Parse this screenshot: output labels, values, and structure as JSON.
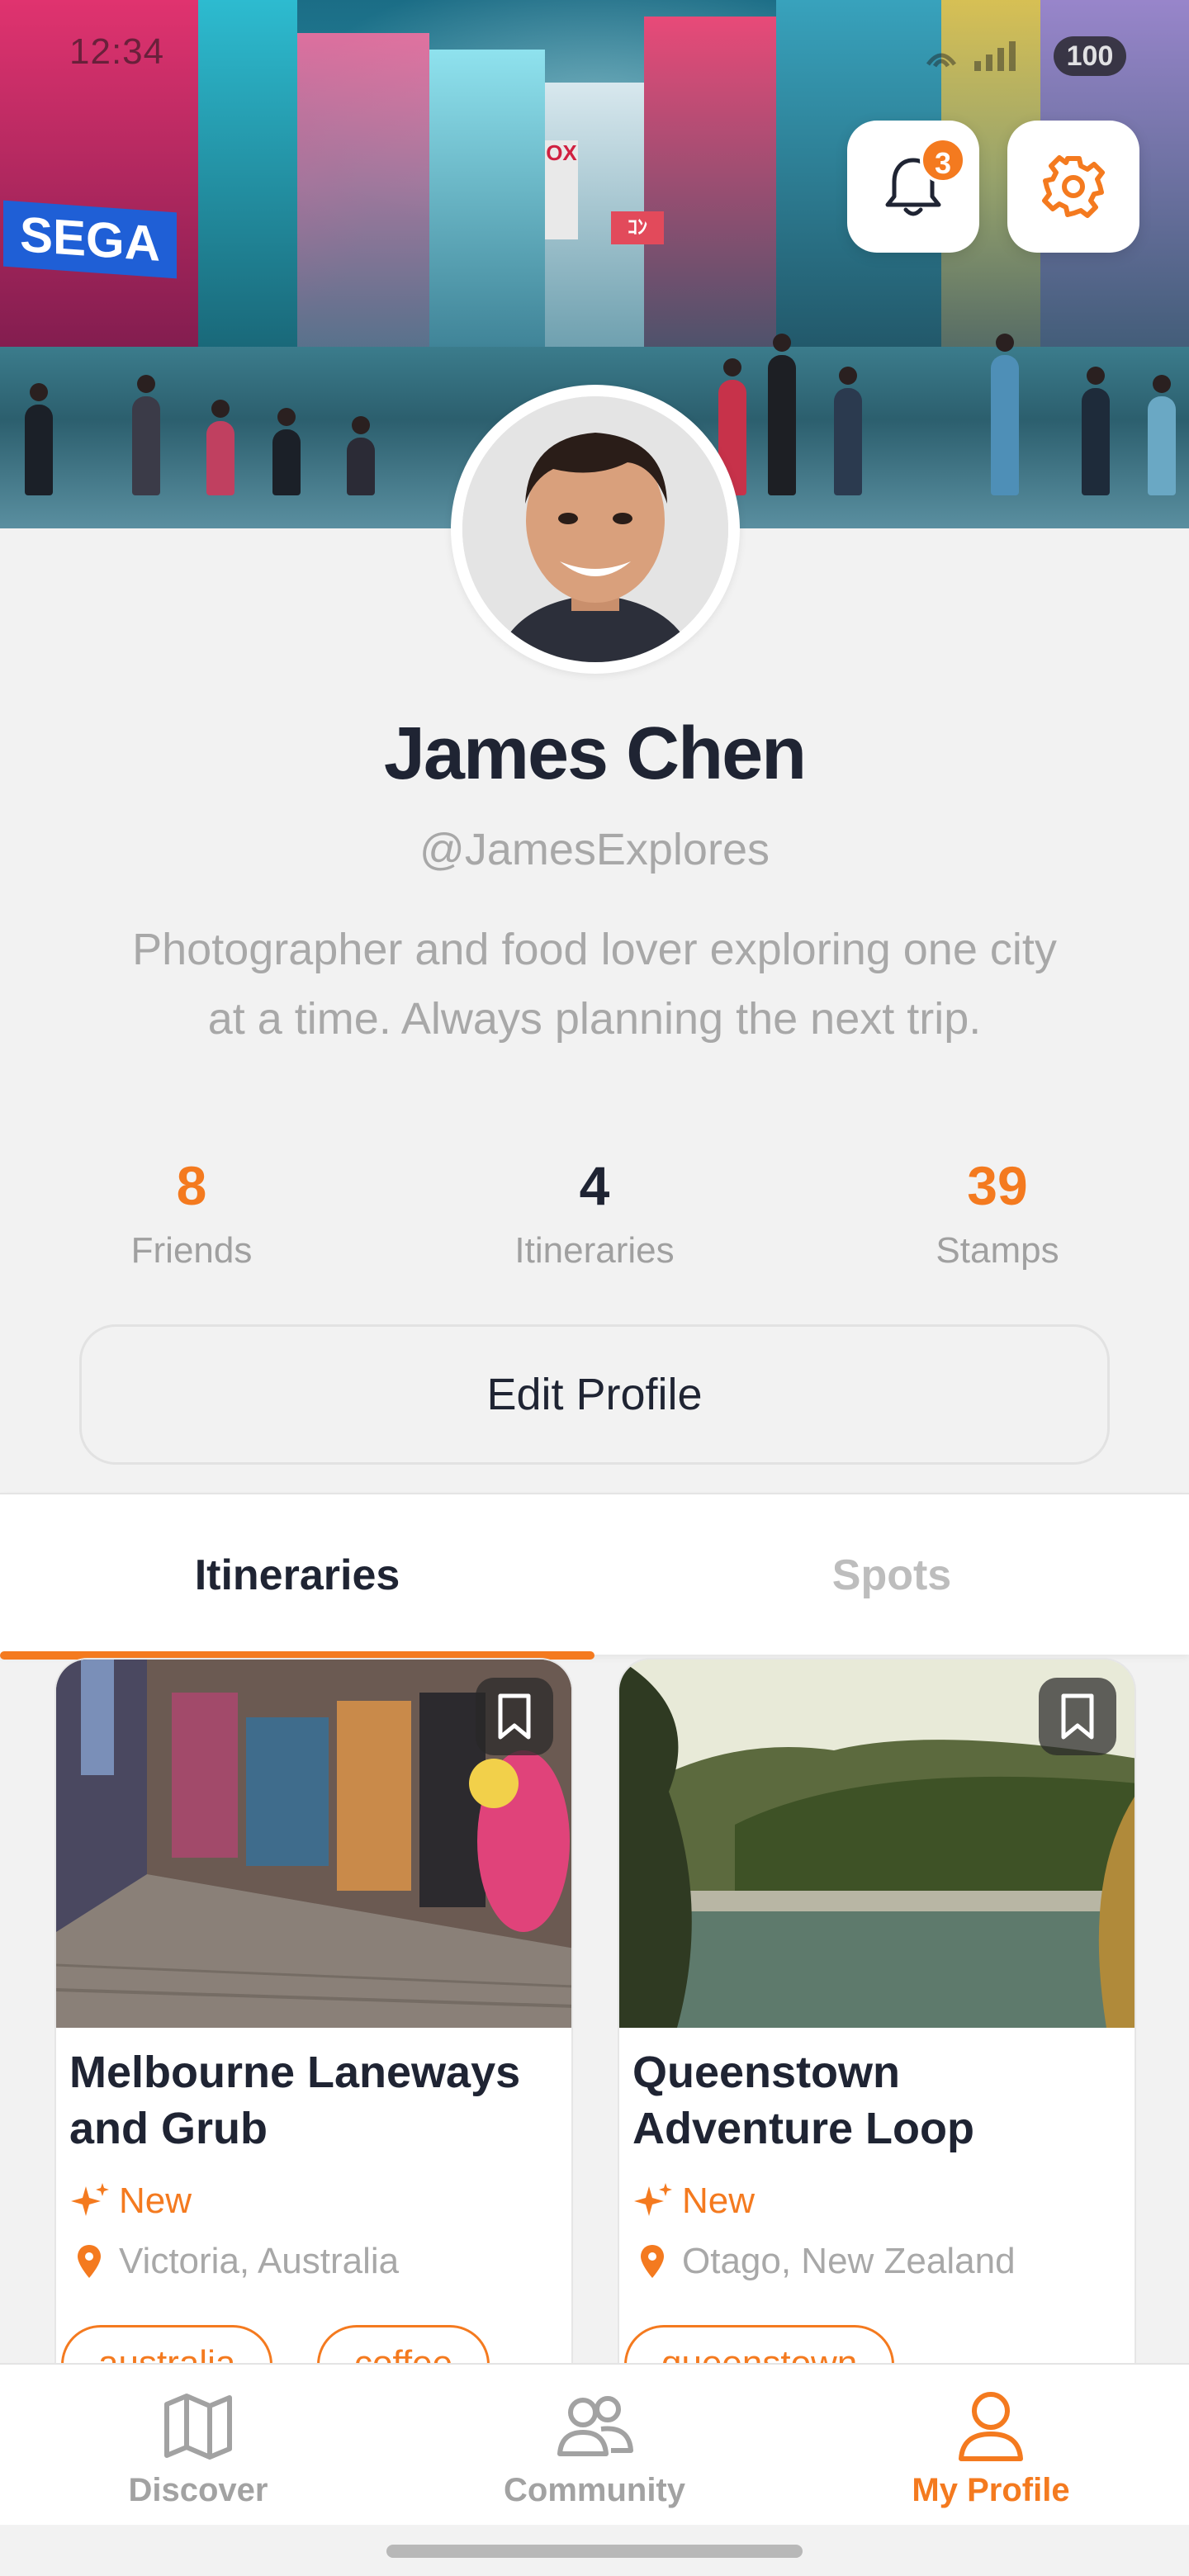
{
  "status_bar": {
    "time": "12:34",
    "battery": "100"
  },
  "header": {
    "notification_count": "3"
  },
  "profile": {
    "name": "James Chen",
    "handle": "@JamesExplores",
    "bio": "Photographer and food lover exploring one city at a time. Always planning the next trip."
  },
  "stats": [
    {
      "value": "8",
      "label": "Friends"
    },
    {
      "value": "4",
      "label": "Itineraries"
    },
    {
      "value": "39",
      "label": "Stamps"
    }
  ],
  "edit_profile_label": "Edit Profile",
  "tabs": [
    {
      "label": "Itineraries",
      "active": true
    },
    {
      "label": "Spots",
      "active": false
    }
  ],
  "cards": [
    {
      "title": "Melbourne Laneways and Grub",
      "status": "New",
      "location": "Victoria, Australia",
      "tags": [
        "australia",
        "coffee"
      ]
    },
    {
      "title": "Queenstown Adventure Loop",
      "status": "New",
      "location": "Otago, New Zealand",
      "tags": [
        "queenstown"
      ]
    }
  ],
  "bottom_nav": [
    {
      "label": "Discover",
      "icon": "map-icon",
      "active": false
    },
    {
      "label": "Community",
      "icon": "people-icon",
      "active": false
    },
    {
      "label": "My Profile",
      "icon": "person-icon",
      "active": true
    }
  ],
  "colors": {
    "accent": "#f47a1f",
    "text_dark": "#1f2433",
    "text_muted": "#a8a8a8",
    "background": "#f2f2f2"
  }
}
